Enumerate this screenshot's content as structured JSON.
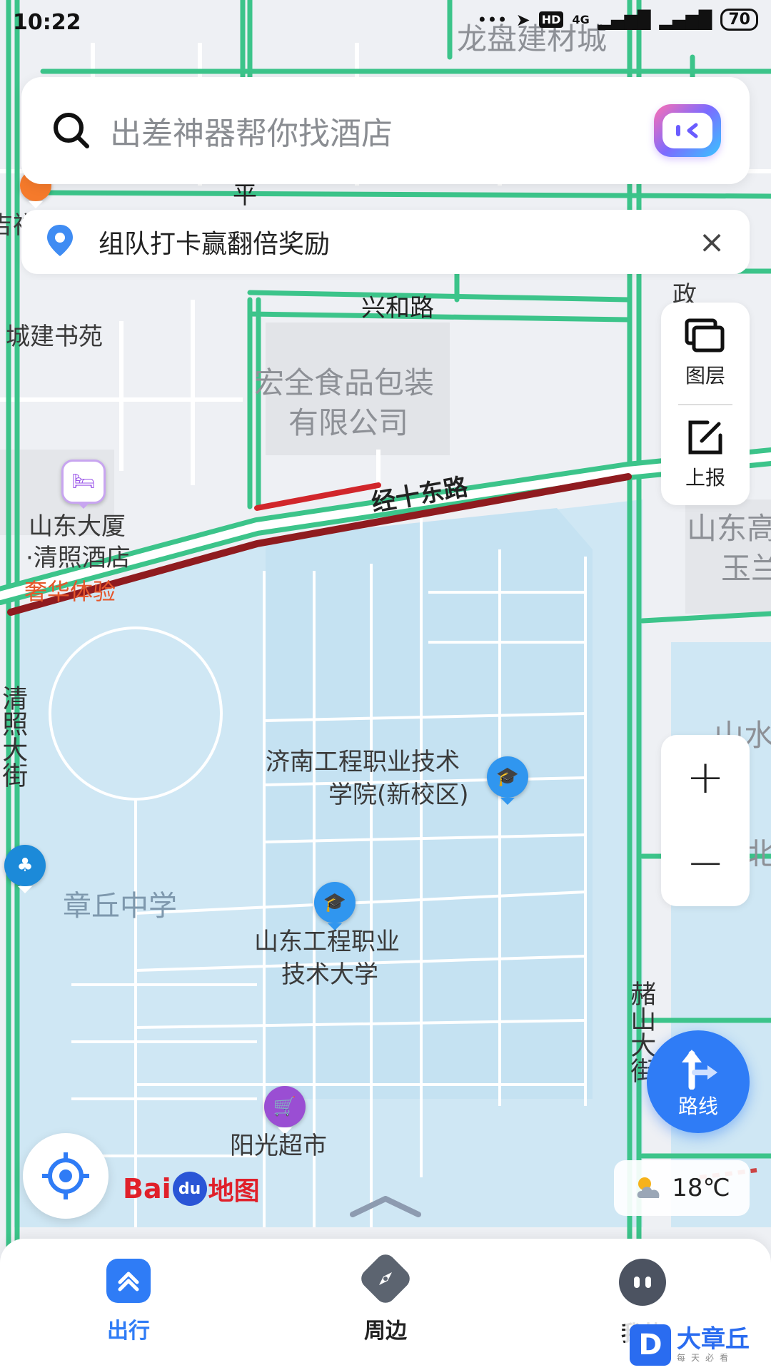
{
  "status_bar": {
    "time": "10:22",
    "network": "4G",
    "hd_label": "HD",
    "battery": "70"
  },
  "search": {
    "placeholder": "出差神器帮你找酒店"
  },
  "promo": {
    "text": "组队打卡赢翻倍奖励",
    "close": "×"
  },
  "tools": {
    "layers_label": "图层",
    "report_label": "上报"
  },
  "zoom": {
    "in_label": "+",
    "out_label": "−"
  },
  "map": {
    "labels": {
      "top_building": "龙盘建材城",
      "road_top": "平",
      "partial_left": "吉祥",
      "xinghe_road": "兴和路",
      "chengjian": "城建书苑",
      "hongquan_1": "宏全食品包装",
      "hongquan_2": "有限公司",
      "jingshi_road": "经十东路",
      "zheng_fragment": "政",
      "hotel_1": "山东大厦",
      "hotel_2": "·清照酒店",
      "hotel_tag": "奢华体验",
      "shandong_gao_1": "山东高",
      "shandong_gao_2": "玉兰",
      "qingzhao_street": "清照大街",
      "jinan_college_1": "济南工程职业技术",
      "jinan_college_2": "学院(新校区)",
      "shanshui": "山水",
      "north_fragment": "北",
      "zhangqiu_school": "章丘中学",
      "sdeu_1": "山东工程职业",
      "sdeu_2": "技术大学",
      "xiushan_street": "赭山大街",
      "sunshine_market": "阳光超市"
    },
    "colors": {
      "road_green": "#3cc48a",
      "road_red": "#d1262b",
      "road_darkred": "#8f1b1f",
      "campus_blue": "#cfe7f4",
      "block_gray": "#e2e4e8",
      "background": "#eef0f4"
    }
  },
  "logo": {
    "bai": "Bai",
    "du": "du",
    "map": "地图"
  },
  "route_button": {
    "label": "路线"
  },
  "weather": {
    "temperature": "18℃",
    "icon": "cloud-sun-icon"
  },
  "bottom_nav": {
    "items": [
      {
        "label": "出行",
        "icon": "travel-icon"
      },
      {
        "label": "周边",
        "icon": "compass-icon"
      },
      {
        "label": "我的",
        "icon": "profile-icon"
      }
    ]
  },
  "watermark": {
    "letter": "D",
    "title": "大章丘",
    "subtitle": "每天必看"
  }
}
